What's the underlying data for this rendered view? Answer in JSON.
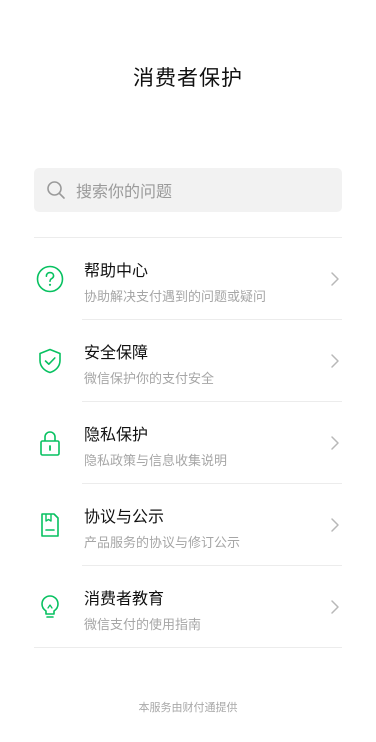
{
  "page": {
    "title": "消费者保护"
  },
  "search": {
    "placeholder": "搜索你的问题",
    "icon": "search-icon"
  },
  "colors": {
    "accent": "#07c160",
    "background": "#ffffff",
    "search_bg": "#f2f2f2",
    "subtitle": "#a6a6a6",
    "chevron": "#b8b8b8"
  },
  "items": [
    {
      "title": "帮助中心",
      "subtitle": "协助解决支付遇到的问题或疑问",
      "icon": "question-circle-icon"
    },
    {
      "title": "安全保障",
      "subtitle": "微信保护你的支付安全",
      "icon": "shield-check-icon"
    },
    {
      "title": "隐私保护",
      "subtitle": "隐私政策与信息收集说明",
      "icon": "lock-icon"
    },
    {
      "title": "协议与公示",
      "subtitle": "产品服务的协议与修订公示",
      "icon": "document-icon"
    },
    {
      "title": "消费者教育",
      "subtitle": "微信支付的使用指南",
      "icon": "lightbulb-icon"
    }
  ],
  "footer": {
    "text": "本服务由财付通提供"
  }
}
